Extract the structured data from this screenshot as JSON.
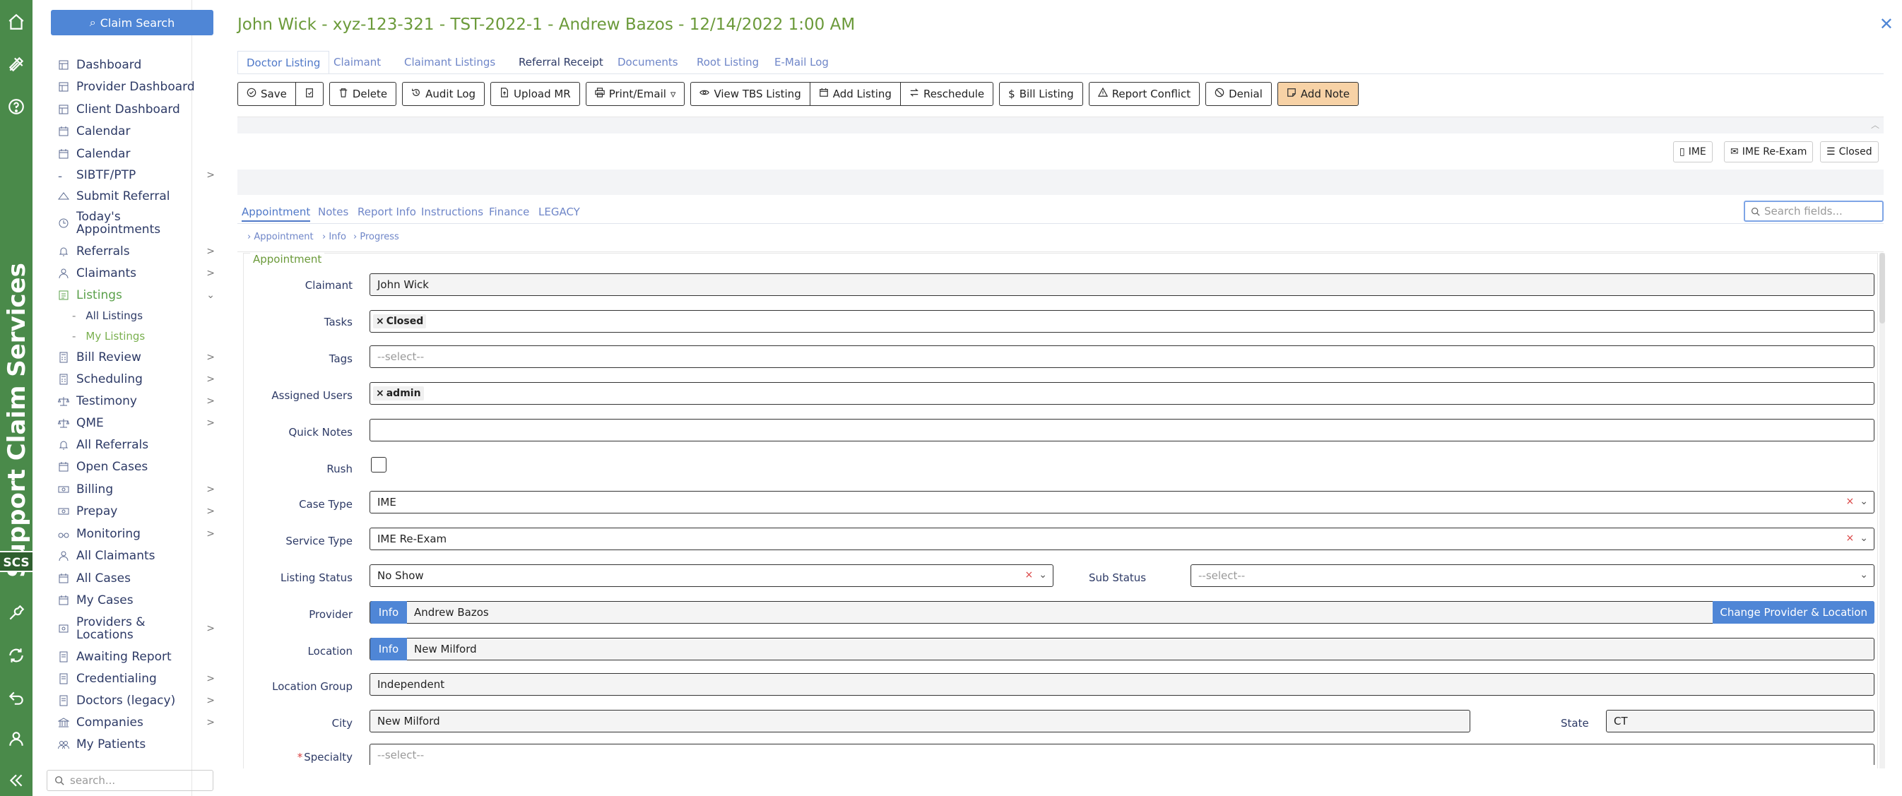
{
  "brand": {
    "vertical_text": "Support Claim Services",
    "logo": "SCS"
  },
  "sidebar": {
    "claim_search": "Claim Search",
    "search_placeholder": "search...",
    "items": [
      {
        "label": "Dashboard",
        "icon": "grid-icon"
      },
      {
        "label": "Provider Dashboard",
        "icon": "grid-icon"
      },
      {
        "label": "Client Dashboard",
        "icon": "grid-icon"
      },
      {
        "label": "Calendar",
        "icon": "calendar-icon"
      },
      {
        "label": "Calendar",
        "icon": "calendar-icon"
      },
      {
        "label": "SIBTF/PTP",
        "icon": "dash-icon"
      },
      {
        "label": "Submit Referral",
        "icon": "ticket-icon"
      },
      {
        "label": "Today's Appointments",
        "icon": "clock-icon"
      },
      {
        "label": "Referrals",
        "icon": "bell-icon"
      },
      {
        "label": "Claimants",
        "icon": "person-icon"
      },
      {
        "label": "Listings",
        "icon": "list-icon"
      },
      {
        "label": "Bill Review",
        "icon": "calculator-icon"
      },
      {
        "label": "Scheduling",
        "icon": "calculator-icon"
      },
      {
        "label": "Testimony",
        "icon": "scale-icon"
      },
      {
        "label": "QME",
        "icon": "scale-icon"
      },
      {
        "label": "All Referrals",
        "icon": "bell-icon"
      },
      {
        "label": "Open Cases",
        "icon": "calendar-icon"
      },
      {
        "label": "Billing",
        "icon": "money-icon"
      },
      {
        "label": "Prepay",
        "icon": "money-icon"
      },
      {
        "label": "Monitoring",
        "icon": "binoculars-icon"
      },
      {
        "label": "All Claimants",
        "icon": "person-icon"
      },
      {
        "label": "All Cases",
        "icon": "calendar-icon"
      },
      {
        "label": "My Cases",
        "icon": "calendar-icon"
      },
      {
        "label": "Providers & Locations",
        "icon": "location-icon"
      },
      {
        "label": "Awaiting Report",
        "icon": "document-icon"
      },
      {
        "label": "Credentialing",
        "icon": "document-icon"
      },
      {
        "label": "Doctors (legacy)",
        "icon": "document-icon"
      },
      {
        "label": "Companies",
        "icon": "bank-icon"
      },
      {
        "label": "My Patients",
        "icon": "people-icon"
      }
    ],
    "listings_sub": [
      "All Listings",
      "My Listings"
    ]
  },
  "header": {
    "title": "John Wick - xyz-123-321 - TST-2022-1 - Andrew Bazos - 12/14/2022 1:00 AM",
    "tabs": [
      "Doctor Listing",
      "Claimant",
      "Claimant Listings",
      "Referral Receipt",
      "Documents",
      "Root Listing",
      "E-Mail Log"
    ]
  },
  "toolbar": {
    "save": "Save",
    "delete": "Delete",
    "audit_log": "Audit Log",
    "upload_mr": "Upload MR",
    "print_email": "Print/Email",
    "view_tbs": "View TBS Listing",
    "add_listing": "Add Listing",
    "reschedule": "Reschedule",
    "bill_listing": "Bill Listing",
    "report_conflict": "Report Conflict",
    "denial": "Denial",
    "add_note": "Add Note"
  },
  "status_chips": [
    "IME",
    "IME Re-Exam",
    "Closed"
  ],
  "subtabs": [
    "Appointment",
    "Notes",
    "Report Info",
    "Instructions",
    "Finance",
    "LEGACY"
  ],
  "field_search_placeholder": "Search fields...",
  "crumbs": [
    "Appointment",
    "Info",
    "Progress"
  ],
  "section_title": "Appointment",
  "form": {
    "claimant": {
      "label": "Claimant",
      "value": "John Wick"
    },
    "tasks": {
      "label": "Tasks",
      "chip": "Closed"
    },
    "tags": {
      "label": "Tags",
      "placeholder": "--select--"
    },
    "assigned_users": {
      "label": "Assigned Users",
      "chip": "admin"
    },
    "quick_notes": {
      "label": "Quick Notes",
      "value": ""
    },
    "rush": {
      "label": "Rush"
    },
    "case_type": {
      "label": "Case Type",
      "value": "IME"
    },
    "service_type": {
      "label": "Service Type",
      "value": "IME Re-Exam"
    },
    "listing_status": {
      "label": "Listing Status",
      "value": "No Show"
    },
    "sub_status": {
      "label": "Sub Status",
      "placeholder": "--select--"
    },
    "provider": {
      "label": "Provider",
      "info": "Info",
      "value": "Andrew Bazos",
      "change": "Change Provider & Location"
    },
    "location": {
      "label": "Location",
      "info": "Info",
      "value": "New Milford"
    },
    "location_group": {
      "label": "Location Group",
      "value": "Independent"
    },
    "city": {
      "label": "City",
      "value": "New Milford"
    },
    "state": {
      "label": "State",
      "value": "CT"
    },
    "specialty": {
      "label": "Specialty",
      "placeholder": "--select--",
      "required_mark": "*"
    }
  }
}
